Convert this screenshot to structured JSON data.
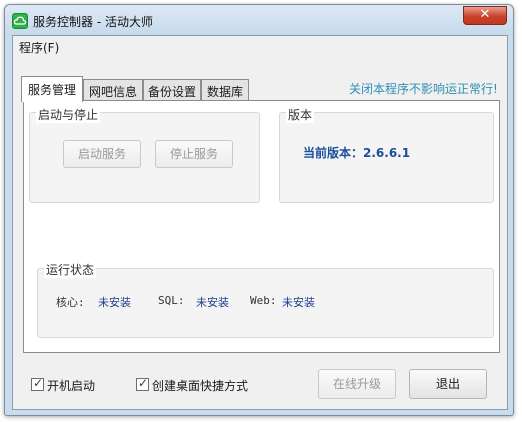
{
  "window": {
    "title": "服务控制器 - 活动大师",
    "close_symbol": "✕"
  },
  "menu": {
    "program": "程序(F)"
  },
  "tabs": [
    {
      "label": "服务管理",
      "active": true
    },
    {
      "label": "网吧信息",
      "active": false
    },
    {
      "label": "备份设置",
      "active": false
    },
    {
      "label": "数据库",
      "active": false
    }
  ],
  "hint": "关闭本程序不影响运正常行!",
  "start_stop": {
    "title": "启动与停止",
    "start_label": "启动服务",
    "stop_label": "停止服务"
  },
  "version": {
    "title": "版本",
    "text": "当前版本：2.6.6.1"
  },
  "status": {
    "title": "运行状态",
    "core_label": "核心:",
    "core_value": "未安装",
    "sql_label": "SQL:",
    "sql_value": "未安装",
    "web_label": "Web:",
    "web_value": "未安装"
  },
  "options": {
    "autostart_label": "开机启动",
    "autostart_checked": true,
    "shortcut_label": "创建桌面快捷方式",
    "shortcut_checked": true
  },
  "actions": {
    "upgrade_label": "在线升级",
    "exit_label": "退出"
  },
  "colors": {
    "hint": "#2e8fb5",
    "version": "#1a4f9c",
    "status_value": "#1d3d8f",
    "close_button": "#c8412a"
  },
  "icons": {
    "app": "green-cloud-icon",
    "check": "✓"
  }
}
